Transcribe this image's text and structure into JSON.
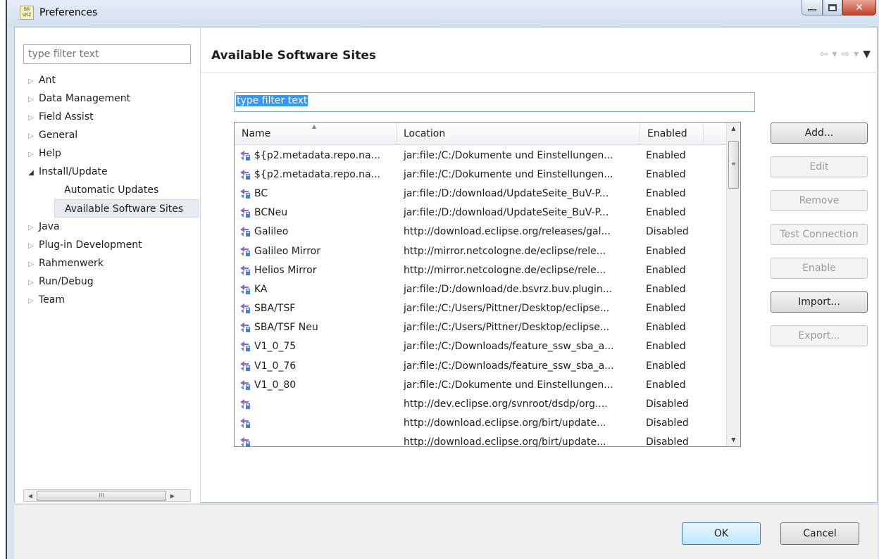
{
  "window": {
    "title": "Preferences",
    "app_icon_text": "BB VRZ"
  },
  "sidebar": {
    "filter_placeholder": "type filter text",
    "items": [
      {
        "label": "Ant",
        "level": 0,
        "expanded": false
      },
      {
        "label": "Data Management",
        "level": 0,
        "expanded": false
      },
      {
        "label": "Field Assist",
        "level": 0,
        "expanded": false
      },
      {
        "label": "General",
        "level": 0,
        "expanded": false
      },
      {
        "label": "Help",
        "level": 0,
        "expanded": false
      },
      {
        "label": "Install/Update",
        "level": 0,
        "expanded": true
      },
      {
        "label": "Automatic Updates",
        "level": 1
      },
      {
        "label": "Available Software Sites",
        "level": 1,
        "selected": true
      },
      {
        "label": "Java",
        "level": 0,
        "expanded": false
      },
      {
        "label": "Plug-in Development",
        "level": 0,
        "expanded": false
      },
      {
        "label": "Rahmenwerk",
        "level": 0,
        "expanded": false
      },
      {
        "label": "Run/Debug",
        "level": 0,
        "expanded": false
      },
      {
        "label": "Team",
        "level": 0,
        "expanded": false
      }
    ]
  },
  "main": {
    "title": "Available Software Sites",
    "filter_text": "type filter text",
    "table": {
      "columns": [
        "Name",
        "Location",
        "Enabled"
      ],
      "rows": [
        {
          "name": "${p2.metadata.repo.na...",
          "location": "jar:file:/C:/Dokumente und Einstellungen...",
          "enabled": "Enabled"
        },
        {
          "name": "${p2.metadata.repo.na...",
          "location": "jar:file:/C:/Dokumente und Einstellungen...",
          "enabled": "Enabled"
        },
        {
          "name": "BC",
          "location": "jar:file:/D:/download/UpdateSeite_BuV-P...",
          "enabled": "Enabled"
        },
        {
          "name": "BCNeu",
          "location": "jar:file:/D:/download/UpdateSeite_BuV-P...",
          "enabled": "Enabled"
        },
        {
          "name": "Galileo",
          "location": "http://download.eclipse.org/releases/gal...",
          "enabled": "Disabled"
        },
        {
          "name": "Galileo Mirror",
          "location": "http://mirror.netcologne.de/eclipse/rele...",
          "enabled": "Enabled"
        },
        {
          "name": "Helios Mirror",
          "location": "http://mirror.netcologne.de/eclipse/rele...",
          "enabled": "Enabled"
        },
        {
          "name": "KA",
          "location": "jar:file:/D:/download/de.bsvrz.buv.plugin...",
          "enabled": "Enabled"
        },
        {
          "name": "SBA/TSF",
          "location": "jar:file:/C:/Users/Pittner/Desktop/eclipse...",
          "enabled": "Enabled"
        },
        {
          "name": "SBA/TSF Neu",
          "location": "jar:file:/C:/Users/Pittner/Desktop/eclipse...",
          "enabled": "Enabled"
        },
        {
          "name": "V1_0_75",
          "location": "jar:file:/C:/Downloads/feature_ssw_sba_a...",
          "enabled": "Enabled"
        },
        {
          "name": "V1_0_76",
          "location": "jar:file:/C:/Downloads/feature_ssw_sba_a...",
          "enabled": "Enabled"
        },
        {
          "name": "V1_0_80",
          "location": "jar:file:/C:/Dokumente und Einstellungen...",
          "enabled": "Enabled"
        },
        {
          "name": "",
          "location": "http://dev.eclipse.org/svnroot/dsdp/org....",
          "enabled": "Disabled"
        },
        {
          "name": "",
          "location": "http://download.eclipse.org/birt/update...",
          "enabled": "Disabled"
        },
        {
          "name": "",
          "location": "http://download.eclipse.org/birt/update...",
          "enabled": "Disabled"
        }
      ]
    },
    "buttons": [
      {
        "label": "Add...",
        "enabled": true
      },
      {
        "label": "Edit",
        "enabled": false
      },
      {
        "label": "Remove",
        "enabled": false
      },
      {
        "label": "Test Connection",
        "enabled": false
      },
      {
        "label": "Enable",
        "enabled": false
      },
      {
        "label": "Import...",
        "enabled": true
      },
      {
        "label": "Export...",
        "enabled": false
      }
    ]
  },
  "footer": {
    "ok_label": "OK",
    "cancel_label": "Cancel"
  },
  "icons": {
    "site": "update-site-icon",
    "close": "close-icon",
    "minimize": "minimize-icon",
    "maximize": "maximize-icon"
  },
  "colors": {
    "selection": "#3399ff",
    "title_bg": "#d9e4f1",
    "close_button": "#c2422a"
  }
}
